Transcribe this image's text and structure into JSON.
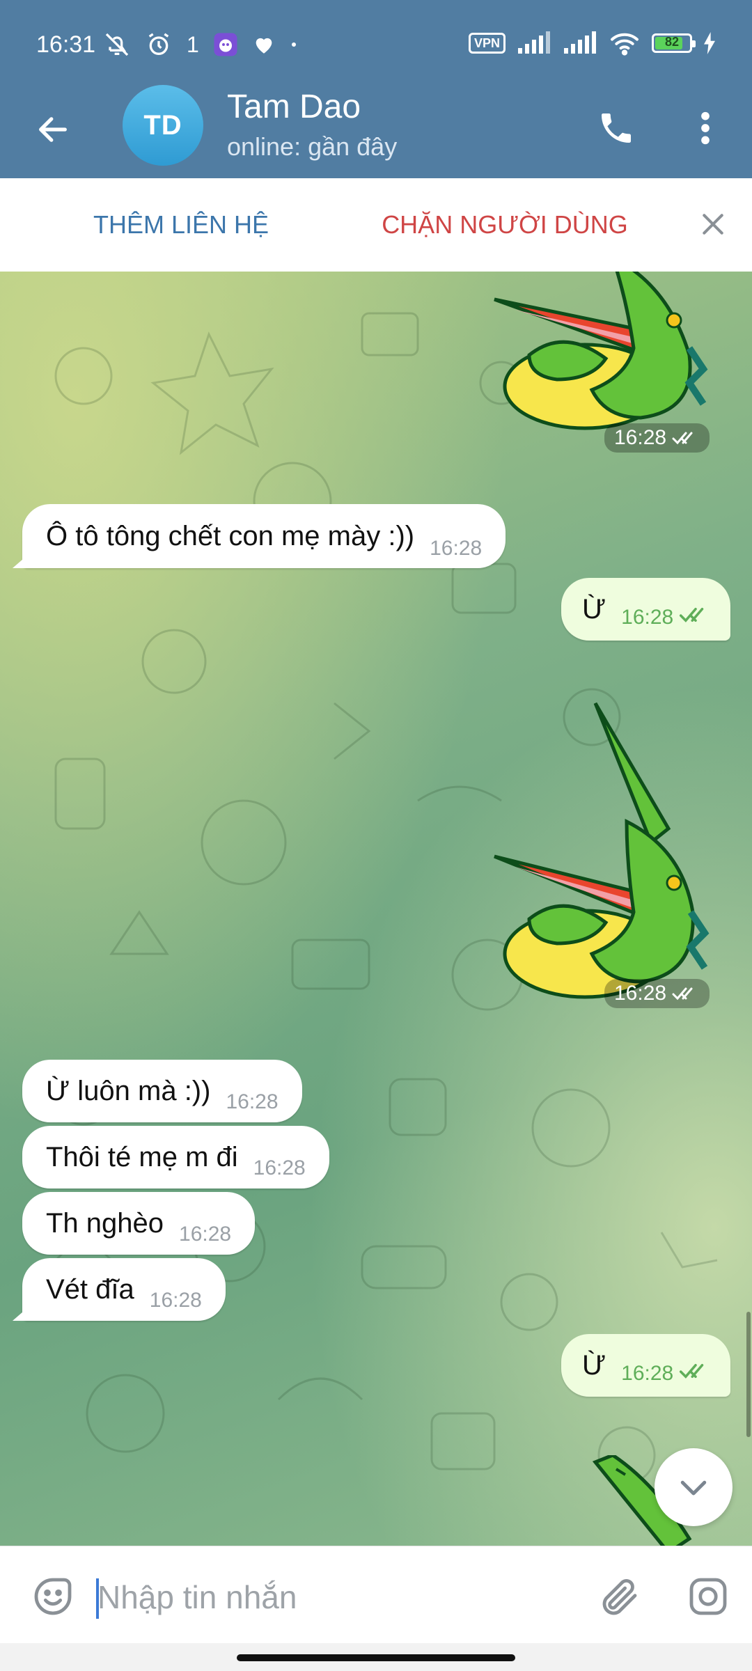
{
  "status_bar": {
    "time": "16:31",
    "signal_extra": "1",
    "vpn_label": "VPN",
    "battery_percent": "82",
    "battery_level": 0.82
  },
  "header": {
    "avatar_initials": "TD",
    "name": "Tam Dao",
    "status": "online: gần đây",
    "colors": {
      "bar": "#517DA2",
      "avatar": "#3DA6DC"
    }
  },
  "actions": {
    "add_contact": "THÊM LIÊN HỆ",
    "block_user": "CHẶN NGƯỜI DÙNG"
  },
  "messages": [
    {
      "direction": "out",
      "type": "sticker",
      "time": "16:28"
    },
    {
      "direction": "in",
      "type": "text",
      "text": "Ô tô tông chết con mẹ mày :))",
      "time": "16:28"
    },
    {
      "direction": "out",
      "type": "text",
      "text": "Ừ",
      "time": "16:28"
    },
    {
      "direction": "out",
      "type": "sticker",
      "time": "16:28"
    },
    {
      "direction": "in",
      "type": "text",
      "text": "Ừ luôn mà :))",
      "time": "16:28"
    },
    {
      "direction": "in",
      "type": "text",
      "text": "Thôi té mẹ m đi",
      "time": "16:28"
    },
    {
      "direction": "in",
      "type": "text",
      "text": "Th nghèo",
      "time": "16:28"
    },
    {
      "direction": "in",
      "type": "text",
      "text": "Vét đĩa",
      "time": "16:28"
    },
    {
      "direction": "out",
      "type": "text",
      "text": "Ừ",
      "time": "16:28"
    },
    {
      "direction": "out",
      "type": "sticker"
    }
  ],
  "composer": {
    "placeholder": "Nhập tin nhắn",
    "value": ""
  },
  "icons": {
    "back": "arrow-left-icon",
    "call": "phone-icon",
    "more": "more-vertical-icon",
    "close": "close-icon",
    "emoji": "sticker-smile-icon",
    "attach": "paperclip-icon",
    "camera": "camera-icon",
    "scroll": "chevron-down-icon"
  }
}
